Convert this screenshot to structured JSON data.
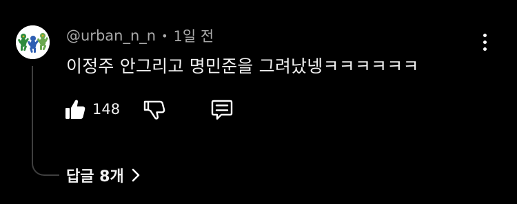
{
  "comment": {
    "author": "@urban_n_n",
    "separator": "•",
    "timestamp": "1일 전",
    "text": "이정주 안그리고 명민준을 그려났넹ㅋㅋㅋㅋㅋㅋ",
    "like_count": "148",
    "replies_label": "답글 8개"
  },
  "icons": {
    "like": "thumbs-up-icon",
    "dislike": "thumbs-down-icon",
    "reply": "comment-icon",
    "more": "more-vertical-icon",
    "expand": "chevron-right-icon"
  },
  "colors": {
    "background": "#000000",
    "primary_text": "#f1f1f1",
    "secondary_text": "#aaaaaa",
    "thread_line": "#3f3f3f"
  }
}
